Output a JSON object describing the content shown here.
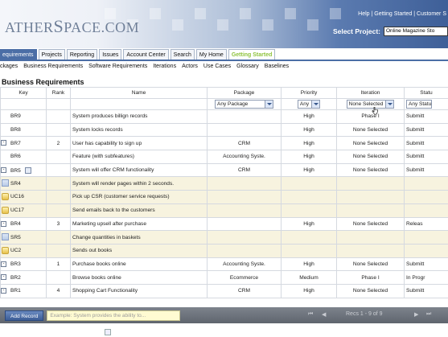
{
  "header": {
    "logo_small": "ATHER",
    "logo_cap": "S",
    "logo_rest": "PACE.COM",
    "top_links": "Help | Getting Started | Customer S",
    "select_project_label": "Select Project:",
    "project_value": "Online Magazine Sto"
  },
  "tabs": [
    "equirements",
    "Projects",
    "Reporting",
    "Issues",
    "Account Center",
    "Search",
    "My Home",
    "Getting Started"
  ],
  "subtabs": [
    "ckages",
    "Business Requirements",
    "Software Requirements",
    "Iterations",
    "Actors",
    "Use Cases",
    "Glossary",
    "Baselines"
  ],
  "section_title": "Business Requirements",
  "columns": {
    "key": "Key",
    "rank": "Rank",
    "name": "Name",
    "package": "Package",
    "priority": "Priority",
    "iteration": "Iteration",
    "status": "Statu"
  },
  "filters": {
    "package": "Any Package",
    "priority": "Any",
    "iteration": "None Selected",
    "status": "Any Statu"
  },
  "rows": [
    {
      "key": "BR9",
      "rank": "",
      "name": "System produces billign records",
      "package": "",
      "priority": "High",
      "iteration": "Phase I",
      "status": "Submitt"
    },
    {
      "key": "BR8",
      "rank": "",
      "name": "System locks records",
      "package": "",
      "priority": "High",
      "iteration": "None Selected",
      "status": "Submitt"
    },
    {
      "key": "BR7",
      "rank": "2",
      "name": "User has capability to sign up",
      "package": "CRM",
      "priority": "High",
      "iteration": "None Selected",
      "status": "Submitt"
    },
    {
      "key": "BR6",
      "rank": "",
      "name": "Feature (with subfeatures)",
      "package": "Accounting Syste.",
      "priority": "High",
      "iteration": "None Selected",
      "status": "Submitt"
    },
    {
      "key": "BR5",
      "rank": "",
      "name": "System will offer CRM functionality",
      "package": "CRM",
      "priority": "High",
      "iteration": "None Selected",
      "status": "Submitt"
    },
    {
      "key": "SR4",
      "rank": "",
      "name": "System will render pages within 2 seconds.",
      "package": "",
      "priority": "",
      "iteration": "",
      "status": ""
    },
    {
      "key": "UC16",
      "rank": "",
      "name": "Pick up CSR (customer service requests)",
      "package": "",
      "priority": "",
      "iteration": "",
      "status": ""
    },
    {
      "key": "UC17",
      "rank": "",
      "name": "Send emails back to the customers",
      "package": "",
      "priority": "",
      "iteration": "",
      "status": ""
    },
    {
      "key": "BR4",
      "rank": "3",
      "name": "Marketing upsell after purchase",
      "package": "",
      "priority": "High",
      "iteration": "None Selected",
      "status": "Releas"
    },
    {
      "key": "SR5",
      "rank": "",
      "name": "Change quantities in baskets",
      "package": "",
      "priority": "",
      "iteration": "",
      "status": ""
    },
    {
      "key": "UC2",
      "rank": "",
      "name": "Sends out books",
      "package": "",
      "priority": "",
      "iteration": "",
      "status": ""
    },
    {
      "key": "BR3",
      "rank": "1",
      "name": "Purchase books online",
      "package": "Accounting Syste.",
      "priority": "High",
      "iteration": "None Selected",
      "status": "Submitt"
    },
    {
      "key": "BR2",
      "rank": "",
      "name": "Browse books online",
      "package": "Ecommerce",
      "priority": "Medium",
      "iteration": "Phase I",
      "status": "In Progr"
    },
    {
      "key": "BR1",
      "rank": "4",
      "name": "Shopping Cart Functionality",
      "package": "CRM",
      "priority": "High",
      "iteration": "None Selected",
      "status": "Submitt"
    }
  ],
  "footer": {
    "add_record": "Add Record",
    "example_placeholder": "Example: System provides the ability to...",
    "pager_first": "⏮",
    "pager_prev": "◀",
    "recs": "Recs 1 - 9 of 9",
    "pager_next": "▶",
    "pager_last": "⏭"
  }
}
